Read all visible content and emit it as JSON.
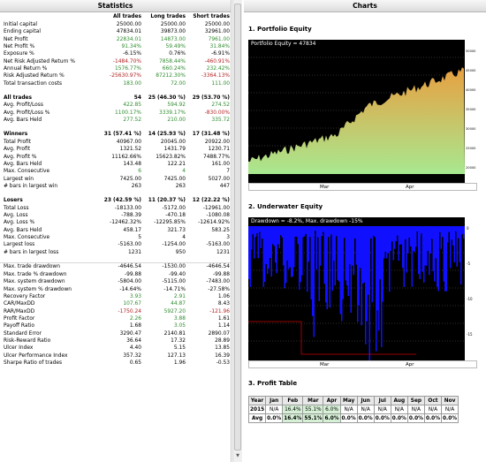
{
  "left": {
    "title": "Statistics",
    "columns": [
      "All trades",
      "Long trades",
      "Short trades"
    ],
    "rows": [
      {
        "label": "Initial capital",
        "v": [
          "25000.00",
          "25000.00",
          "25000.00"
        ],
        "c": [
          "",
          "",
          ""
        ]
      },
      {
        "label": "Ending capital",
        "v": [
          "47834.01",
          "39873.00",
          "32961.00"
        ],
        "c": [
          "",
          "",
          ""
        ]
      },
      {
        "label": "Net Profit",
        "v": [
          "22834.01",
          "14873.00",
          "7961.00"
        ],
        "c": [
          "pos",
          "pos",
          "pos"
        ]
      },
      {
        "label": "Net Profit %",
        "v": [
          "91.34%",
          "59.49%",
          "31.84%"
        ],
        "c": [
          "pos",
          "pos",
          "pos"
        ]
      },
      {
        "label": "Exposure %",
        "v": [
          "-6.15%",
          "0.76%",
          "-6.91%"
        ],
        "c": [
          "",
          "",
          ""
        ]
      },
      {
        "label": "Net Risk Adjusted Return %",
        "v": [
          "-1484.70%",
          "7858.44%",
          "-460.91%"
        ],
        "c": [
          "neg",
          "pos",
          "neg"
        ]
      },
      {
        "label": "Annual Return %",
        "v": [
          "1576.77%",
          "660.24%",
          "232.42%"
        ],
        "c": [
          "pos",
          "pos",
          "pos"
        ]
      },
      {
        "label": "Risk Adjusted Return %",
        "v": [
          "-25630.97%",
          "87212.30%",
          "-3364.13%"
        ],
        "c": [
          "neg",
          "pos",
          "neg"
        ]
      },
      {
        "label": "Total transaction costs",
        "v": [
          "183.00",
          "72.00",
          "111.00"
        ],
        "c": [
          "pos",
          "pos",
          "pos"
        ]
      },
      {
        "gap": true
      },
      {
        "label": "All trades",
        "v": [
          "54",
          "25 (46.30 %)",
          "29 (53.70 %)"
        ],
        "c": [
          "",
          "",
          ""
        ],
        "sec": true
      },
      {
        "label": "Avg. Profit/Loss",
        "v": [
          "422.85",
          "594.92",
          "274.52"
        ],
        "c": [
          "pos",
          "pos",
          "pos"
        ]
      },
      {
        "label": "Avg. Profit/Loss %",
        "v": [
          "1100.17%",
          "3339.17%",
          "-830.00%"
        ],
        "c": [
          "pos",
          "pos",
          "neg"
        ]
      },
      {
        "label": "Avg. Bars Held",
        "v": [
          "277.52",
          "210.00",
          "335.72"
        ],
        "c": [
          "pos",
          "pos",
          "pos"
        ]
      },
      {
        "gap": true
      },
      {
        "label": "Winners",
        "v": [
          "31 (57.41 %)",
          "14 (25.93 %)",
          "17 (31.48 %)"
        ],
        "c": [
          "",
          "",
          ""
        ],
        "sec": true
      },
      {
        "label": "Total Profit",
        "v": [
          "40967.00",
          "20045.00",
          "20922.00"
        ],
        "c": [
          "",
          "",
          ""
        ]
      },
      {
        "label": "Avg. Profit",
        "v": [
          "1321.52",
          "1431.79",
          "1230.71"
        ],
        "c": [
          "",
          "",
          ""
        ]
      },
      {
        "label": "Avg. Profit %",
        "v": [
          "11162.66%",
          "15623.82%",
          "7488.77%"
        ],
        "c": [
          "",
          "",
          ""
        ]
      },
      {
        "label": "Avg. Bars Held",
        "v": [
          "143.48",
          "122.21",
          "161.00"
        ],
        "c": [
          "",
          "",
          ""
        ]
      },
      {
        "label": "Max. Consecutive",
        "v": [
          "6",
          "4",
          "7"
        ],
        "c": [
          "pos",
          "pos",
          ""
        ]
      },
      {
        "label": "Largest win",
        "v": [
          "7425.00",
          "7425.00",
          "5027.00"
        ],
        "c": [
          "",
          "",
          ""
        ]
      },
      {
        "label": "# bars in largest win",
        "v": [
          "263",
          "263",
          "447"
        ],
        "c": [
          "",
          "",
          ""
        ]
      },
      {
        "gap": true
      },
      {
        "label": "Losers",
        "v": [
          "23 (42.59 %)",
          "11 (20.37 %)",
          "12 (22.22 %)"
        ],
        "c": [
          "",
          "",
          ""
        ],
        "sec": true
      },
      {
        "label": "Total Loss",
        "v": [
          "-18133.00",
          "-5172.00",
          "-12961.00"
        ],
        "c": [
          "",
          "",
          ""
        ]
      },
      {
        "label": "Avg. Loss",
        "v": [
          "-788.39",
          "-470.18",
          "-1080.08"
        ],
        "c": [
          "",
          "",
          ""
        ]
      },
      {
        "label": "Avg. Loss %",
        "v": [
          "-12462.32%",
          "-12295.85%",
          "-12614.92%"
        ],
        "c": [
          "",
          "",
          ""
        ]
      },
      {
        "label": "Avg. Bars Held",
        "v": [
          "458.17",
          "321.73",
          "583.25"
        ],
        "c": [
          "",
          "",
          ""
        ]
      },
      {
        "label": "Max. Consecutive",
        "v": [
          "5",
          "4",
          "3"
        ],
        "c": [
          "",
          "",
          ""
        ]
      },
      {
        "label": "Largest loss",
        "v": [
          "-5163.00",
          "-1254.00",
          "-5163.00"
        ],
        "c": [
          "",
          "",
          ""
        ]
      },
      {
        "label": "# bars in largest loss",
        "v": [
          "1231",
          "950",
          "1231"
        ],
        "c": [
          "",
          "",
          ""
        ]
      },
      {
        "gap": true
      },
      {
        "label": "Max. trade drawdown",
        "v": [
          "-4646.54",
          "-1530.00",
          "-4646.54"
        ],
        "c": [
          "",
          "",
          ""
        ],
        "sep": true
      },
      {
        "label": "Max. trade % drawdown",
        "v": [
          "-99.88",
          "-99.40",
          "-99.88"
        ],
        "c": [
          "",
          "",
          ""
        ]
      },
      {
        "label": "Max. system drawdown",
        "v": [
          "-5804.00",
          "-5115.00",
          "-7483.00"
        ],
        "c": [
          "",
          "",
          ""
        ]
      },
      {
        "label": "Max. system % drawdown",
        "v": [
          "-14.64%",
          "-14.71%",
          "-27.58%"
        ],
        "c": [
          "",
          "",
          ""
        ]
      },
      {
        "label": "Recovery Factor",
        "v": [
          "3.93",
          "2.91",
          "1.06"
        ],
        "c": [
          "pos",
          "pos",
          ""
        ]
      },
      {
        "label": "CAR/MaxDD",
        "v": [
          "107.67",
          "44.87",
          "8.43"
        ],
        "c": [
          "pos",
          "pos",
          ""
        ]
      },
      {
        "label": "RAR/MaxDD",
        "v": [
          "-1750.24",
          "5927.20",
          "-121.96"
        ],
        "c": [
          "neg",
          "pos",
          "neg"
        ]
      },
      {
        "label": "Profit Factor",
        "v": [
          "2.26",
          "3.88",
          "1.61"
        ],
        "c": [
          "pos",
          "pos",
          ""
        ]
      },
      {
        "label": "Payoff Ratio",
        "v": [
          "1.68",
          "3.05",
          "1.14"
        ],
        "c": [
          "",
          "pos",
          ""
        ]
      },
      {
        "label": "Standard Error",
        "v": [
          "3290.47",
          "2140.81",
          "2890.07"
        ],
        "c": [
          "",
          "",
          ""
        ]
      },
      {
        "label": "Risk-Reward Ratio",
        "v": [
          "36.64",
          "17.32",
          "28.89"
        ],
        "c": [
          "",
          "",
          ""
        ]
      },
      {
        "label": "Ulcer Index",
        "v": [
          "4.40",
          "5.15",
          "13.85"
        ],
        "c": [
          "",
          "",
          ""
        ]
      },
      {
        "label": "Ulcer Performance Index",
        "v": [
          "357.32",
          "127.13",
          "16.39"
        ],
        "c": [
          "",
          "",
          ""
        ]
      },
      {
        "label": "Sharpe Ratio of trades",
        "v": [
          "0.65",
          "1.96",
          "-0.53"
        ],
        "c": [
          "",
          "",
          ""
        ]
      }
    ]
  },
  "right": {
    "title": "Charts",
    "portfolio": {
      "heading": "1. Portfolio Equity",
      "label": "Portfolio Equity = 47834",
      "months": [
        "Mar",
        "Apr"
      ],
      "scale": [
        "50000",
        "45000",
        "40000",
        "35000",
        "30000",
        "25000",
        "20000"
      ],
      "fill_top_color": "#e8a040",
      "fill_bottom_color": "#a8e890"
    },
    "underwater": {
      "heading": "2. Underwater Equity",
      "label": "Drawdown = -8.2%, Max. drawdown -15%",
      "months": [
        "Mar",
        "Apr"
      ],
      "scale": [
        "0",
        "-5",
        "-10",
        "-15"
      ],
      "bar_color": "#1010ff",
      "line_color": "#cc0000"
    },
    "profit_table": {
      "heading": "3. Profit Table",
      "header": [
        "Year",
        "Jan",
        "Feb",
        "Mar",
        "Apr",
        "May",
        "Jun",
        "Jul",
        "Aug",
        "Sep",
        "Oct",
        "Nov"
      ],
      "rows": [
        [
          "2015",
          "N/A",
          "16.4%",
          "55.1%",
          "6.0%",
          "N/A",
          "N/A",
          "N/A",
          "N/A",
          "N/A",
          "N/A",
          "N/A"
        ],
        [
          "Avg",
          "0.0%",
          "16.4%",
          "55.1%",
          "6.0%",
          "0.0%",
          "0.0%",
          "0.0%",
          "0.0%",
          "0.0%",
          "0.0%",
          "0.0%"
        ]
      ]
    }
  }
}
